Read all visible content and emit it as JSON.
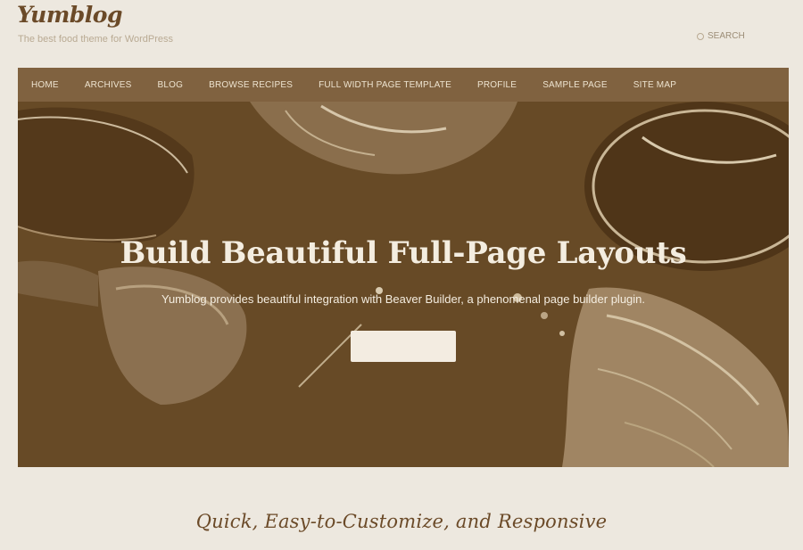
{
  "header": {
    "site_title": "Yumblog",
    "tagline": "The best food theme for WordPress",
    "search_label": "SEARCH"
  },
  "nav": {
    "items": [
      {
        "label": "Home"
      },
      {
        "label": "Archives"
      },
      {
        "label": "Blog"
      },
      {
        "label": "Browse Recipes"
      },
      {
        "label": "Full Width Page Template"
      },
      {
        "label": "Profile"
      },
      {
        "label": "Sample Page"
      },
      {
        "label": "Site Map"
      }
    ]
  },
  "hero": {
    "title": "Build Beautiful Full-Page Layouts",
    "subtitle": "Yumblog provides beautiful integration with Beaver Builder, a phenomenal page builder plugin.",
    "button_label": ""
  },
  "section": {
    "title": "Quick, Easy-to-Customize, and Responsive"
  },
  "colors": {
    "brand_brown": "#6b4a28",
    "page_background": "#ede8df",
    "hero_background": "#674a26",
    "nav_background": "#806240"
  }
}
